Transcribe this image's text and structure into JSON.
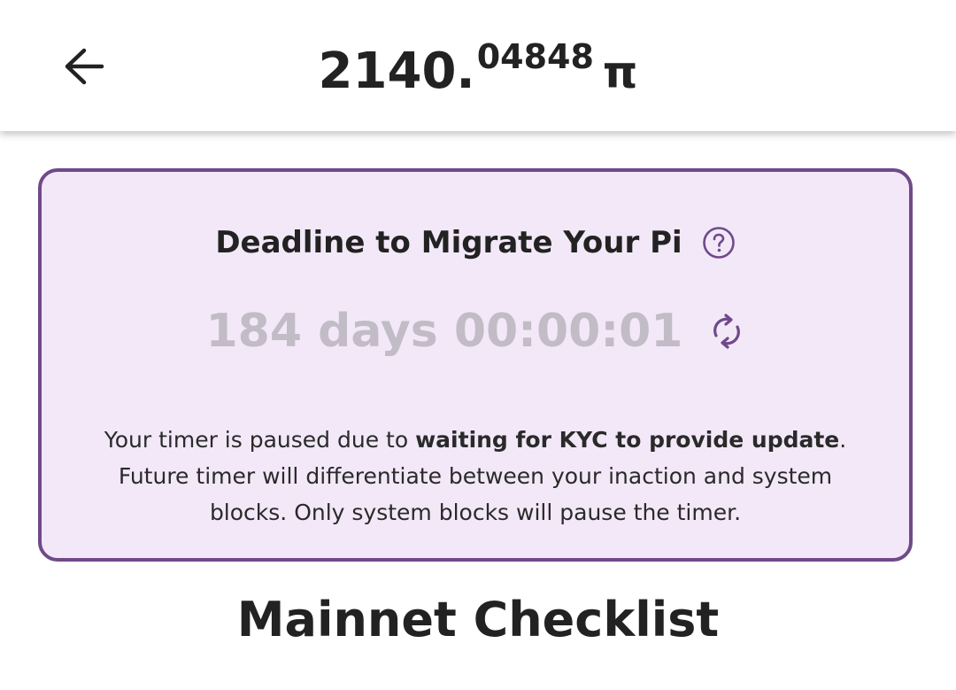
{
  "header": {
    "balance_int": "2140.",
    "balance_frac": "04848",
    "currency_symbol": "π",
    "back_icon": "arrow-left-icon"
  },
  "migration_card": {
    "title": "Deadline to Migrate Your Pi",
    "help_icon": "question-circle-icon",
    "countdown": "184 days 00:00:01",
    "refresh_icon": "sync-icon",
    "note_prefix": "Your timer is paused due to ",
    "note_bold": "waiting for KYC to provide update",
    "note_suffix": ". Future timer will differentiate between your inaction and system blocks. Only system blocks will pause the timer."
  },
  "checklist": {
    "title": "Mainnet Checklist"
  },
  "colors": {
    "card_border": "#6f4a8a",
    "card_background": "#f2e8f8",
    "timer_text": "#c1bcc5",
    "text": "#222222"
  }
}
